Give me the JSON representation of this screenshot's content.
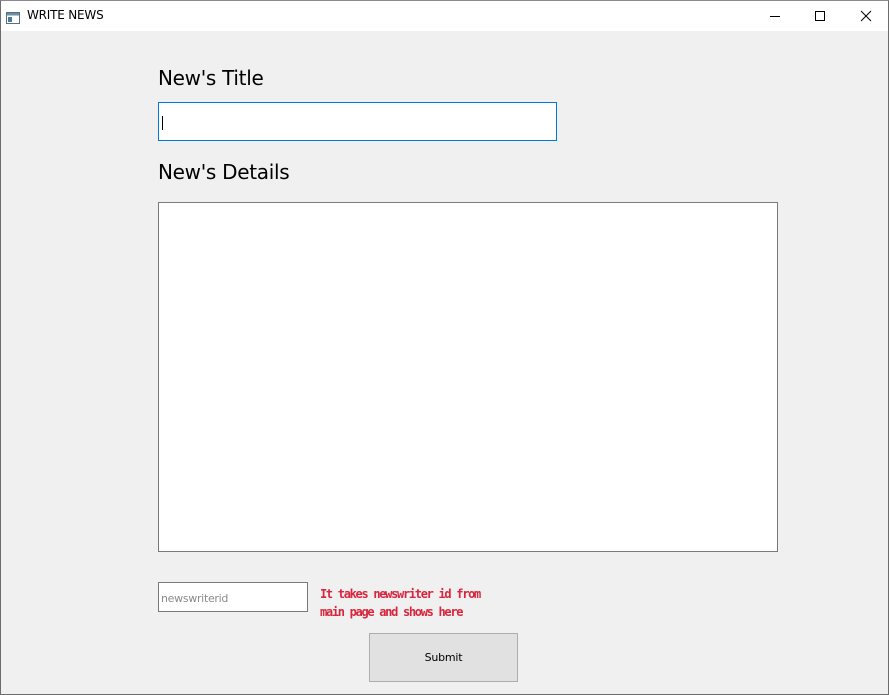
{
  "window": {
    "title": "WRITE NEWS",
    "app_icon": "window-app-icon",
    "minimize_icon": "minimize-icon",
    "maximize_icon": "maximize-icon",
    "close_icon": "close-icon"
  },
  "form": {
    "title_label": "New's Title",
    "title_value": "",
    "details_label": "New's Details",
    "details_value": "",
    "writer_id_value": "newswriterid",
    "note_line1": "It takes newswriter id from",
    "note_line2": "main page and shows here",
    "submit_label": "Submit"
  },
  "colors": {
    "focus_border": "#0078d7",
    "note_text": "#d7263d",
    "button_bg": "#e1e1e1"
  }
}
